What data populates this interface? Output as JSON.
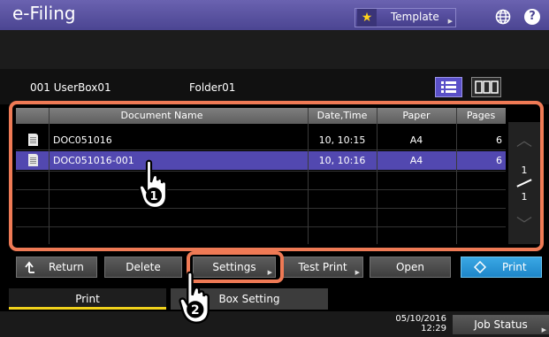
{
  "header": {
    "title": "e-Filing",
    "template_label": "Template"
  },
  "info": {
    "box": "001 UserBox01",
    "folder": "Folder01"
  },
  "table": {
    "columns": [
      "Document Name",
      "Date,Time",
      "Paper",
      "Pages"
    ],
    "rows": [
      {
        "name": "DOC051016",
        "datetime": "10, 10:15",
        "paper": "A4",
        "pages": "6",
        "selected": false
      },
      {
        "name": "DOC051016-001",
        "datetime": "10, 10:16",
        "paper": "A4",
        "pages": "6",
        "selected": true
      }
    ]
  },
  "pager": {
    "current": "1",
    "total": "1"
  },
  "buttons": {
    "return": "Return",
    "delete": "Delete",
    "settings": "Settings",
    "test_print": "Test Print",
    "open": "Open",
    "print": "Print"
  },
  "tabs": {
    "print": "Print",
    "box_setting": "Box Setting"
  },
  "footer": {
    "date": "05/10/2016",
    "time": "12:29",
    "job_status": "Job Status"
  },
  "callouts": {
    "step1": "1",
    "step2": "2"
  },
  "colors": {
    "accent": "#5248b0",
    "highlight": "#ef7a55",
    "print": "#1e86c9",
    "tab_active": "#f1d21c"
  }
}
